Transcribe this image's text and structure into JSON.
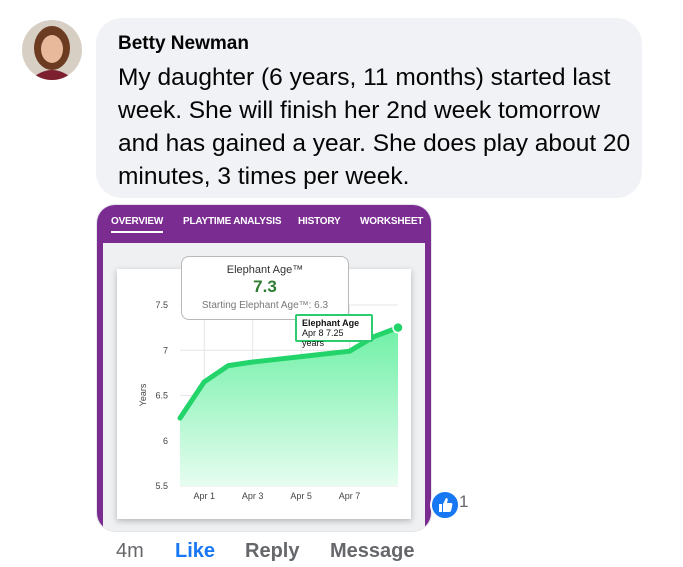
{
  "comment": {
    "author": "Betty Newman",
    "text": "My daughter (6 years, 11 months) started last week. She will finish her 2nd week tomorrow and has gained a year. She does play about 20 minutes, 3 times per week."
  },
  "app_card": {
    "tabs": [
      "OVERVIEW",
      "PLAYTIME ANALYSIS",
      "HISTORY",
      "WORKSHEET"
    ],
    "active_tab": "OVERVIEW",
    "elephant_age_title": "Elephant Age™",
    "elephant_age_value": "7.3",
    "starting_label": "Starting Elephant Age™: 6.3",
    "tooltip_title": "Elephant Age",
    "tooltip_text": "Apr 8 7.25 years"
  },
  "chart_data": {
    "type": "area",
    "ylabel": "Years",
    "xlabel": "",
    "x_ticks": [
      "Apr 1",
      "Apr 3",
      "Apr 5",
      "Apr 7"
    ],
    "y_ticks": [
      "5.5",
      "6",
      "6.5",
      "7",
      "7.5"
    ],
    "ylim": [
      5.5,
      7.5
    ],
    "x_domain_days": [
      0,
      9
    ],
    "series": [
      {
        "points": [
          {
            "day": 0,
            "value": 6.25
          },
          {
            "day": 1,
            "value": 6.65
          },
          {
            "day": 2,
            "value": 6.83
          },
          {
            "day": 3,
            "value": 6.87
          },
          {
            "day": 4,
            "value": 6.9
          },
          {
            "day": 5,
            "value": 6.93
          },
          {
            "day": 6,
            "value": 6.96
          },
          {
            "day": 7,
            "value": 6.99
          },
          {
            "day": 8,
            "value": 7.15
          },
          {
            "day": 9,
            "value": 7.25
          }
        ]
      }
    ],
    "colors": {
      "line": "#22d46a",
      "fill_top": "#6ff0a6",
      "fill_bottom": "#e6fdf0"
    }
  },
  "reactions": {
    "like_count": "1"
  },
  "actions": {
    "time": "4m",
    "like": "Like",
    "reply": "Reply",
    "message": "Message"
  }
}
